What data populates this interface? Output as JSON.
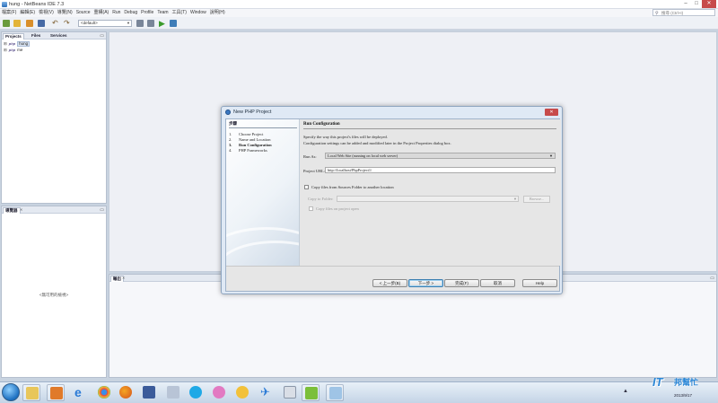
{
  "app": {
    "title": "hung - NetBeans IDE 7.3",
    "window_buttons": [
      "–",
      "□",
      "✕"
    ]
  },
  "menu": {
    "items": [
      "檔案(F)",
      "編輯(E)",
      "檢視(V)",
      "導覽(N)",
      "Source",
      "重構(A)",
      "Run",
      "Debug",
      "Profile",
      "Team",
      "工具(T)",
      "Window",
      "說明(H)"
    ]
  },
  "search": {
    "placeholder": "搜尋 (Ctrl+I)"
  },
  "toolbar": {
    "config_value": "<default>",
    "icons": [
      "new-file-icon",
      "new-project-icon",
      "open-project-icon",
      "save-all-icon",
      "undo-icon",
      "redo-icon",
      "build-icon",
      "clean-build-icon",
      "run-icon",
      "debug-icon"
    ]
  },
  "projects_panel": {
    "tabs": [
      "Projects",
      "Files",
      "Services"
    ],
    "items": [
      {
        "expander": "⊞",
        "icon": "php",
        "label": "hung"
      },
      {
        "expander": "⊞",
        "icon": "php",
        "label": "me"
      }
    ]
  },
  "navigator_panel": {
    "tab": "導覽器",
    "empty_text": "<無可用的檢視>"
  },
  "output_panel": {
    "tab": "輸出"
  },
  "dialog": {
    "title": "New PHP Project",
    "steps_title": "步驟",
    "steps": [
      {
        "num": "1.",
        "label": "Choose Project",
        "current": false
      },
      {
        "num": "2.",
        "label": "Name and Location",
        "current": false
      },
      {
        "num": "3.",
        "label": "Run Configuration",
        "current": true
      },
      {
        "num": "4.",
        "label": "PHP Frameworks",
        "current": false
      }
    ],
    "content_title": "Run Configuration",
    "desc_line1": "Specify the way this project's files will be deployed.",
    "desc_line2": "Configuration settings can be added and modified later in the Project Properties dialog box.",
    "run_as_label": "Run As:",
    "run_as_value": "Local Web Site (running on local web server)",
    "project_url_label": "Project URL:",
    "project_url_value": "http://localhost/PhpProject1/",
    "copy_files_label": "Copy files from Sources Folder to another location",
    "copy_to_label": "Copy to Folder:",
    "browse_label": "Browse...",
    "copy_on_open_label": "Copy files on project open",
    "buttons": {
      "back": "< 上一步(B)",
      "next": "下一步 >",
      "finish": "完成(F)",
      "cancel": "取消",
      "help": "Help"
    }
  },
  "taskbar": {
    "pinned_apps": [
      "explorer-icon",
      "media-player-icon",
      "internet-explorer-icon",
      "chrome-icon",
      "firefox-icon",
      "messenger-icon",
      "notes-icon",
      "skype-icon",
      "game-icon",
      "smiley-app-icon",
      "paper-plane-icon",
      "grid-app-icon",
      "android-icon",
      "netbeans-icon"
    ],
    "date": "2013/9/17"
  },
  "watermark": {
    "latin": "IT",
    "chinese": "邦幫忙"
  },
  "colors": {
    "accent": "#3a78c2",
    "close_red": "#c74b4b",
    "dialog_frame": "#dfe9f5",
    "next_button_focus": "#3c7fb1"
  }
}
